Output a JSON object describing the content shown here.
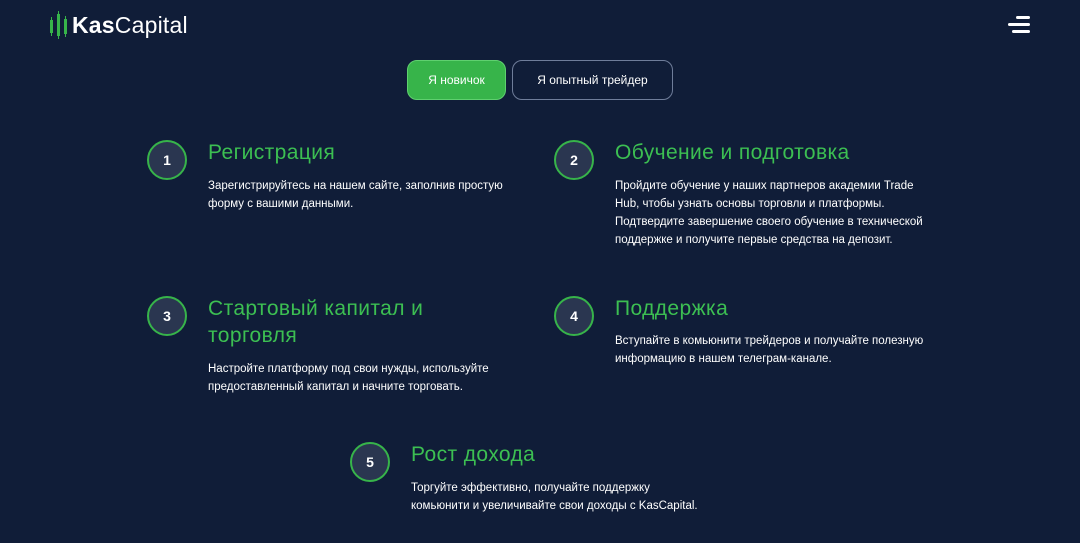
{
  "header": {
    "logo_bold": "Kas",
    "logo_regular": "Capital",
    "colors": {
      "accent": "#37b44a",
      "background": "#101d38"
    },
    "menu_icon": "menu-icon"
  },
  "tabs": [
    {
      "label": "Я новичок",
      "active": true
    },
    {
      "label": "Я опытный трейдер",
      "active": false
    }
  ],
  "steps": [
    {
      "number": "1",
      "title": "Регистрация",
      "description": "Зарегистрируйтесь на нашем сайте, заполнив простую форму с вашими данными."
    },
    {
      "number": "2",
      "title": "Обучение и подготовка",
      "description": "Пройдите обучение у наших партнеров академии Trade Hub, чтобы узнать основы торговли и платформы. Подтвердите завершение своего обучение в технической поддержке и получите первые средства на депозит."
    },
    {
      "number": "3",
      "title": "Стартовый капитал и торговля",
      "description": "Настройте платформу под свои нужды, используйте предоставленный капитал и начните торговать."
    },
    {
      "number": "4",
      "title": "Поддержка",
      "description": "Вступайте в комьюнити трейдеров и получайте полезную информацию в нашем телеграм-канале."
    },
    {
      "number": "5",
      "title": "Рост дохода",
      "description": "Торгуйте эффективно, получайте поддержку комьюнити и увеличивайте свои доходы с KasCapital."
    }
  ]
}
